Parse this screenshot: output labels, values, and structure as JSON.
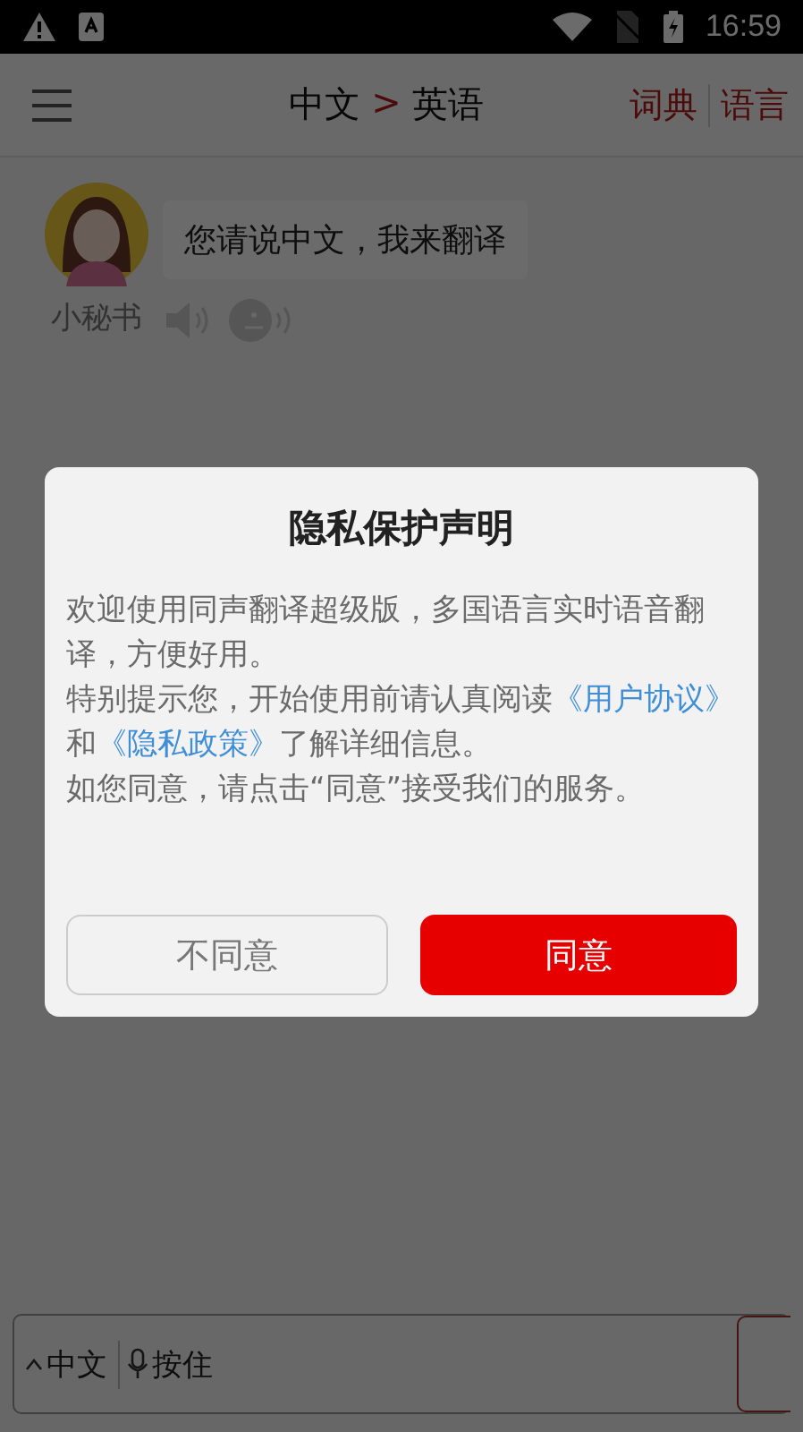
{
  "status_bar": {
    "time": "16:59"
  },
  "header": {
    "source_language": "中文",
    "arrow": ">",
    "target_language": "英语",
    "actions": [
      {
        "label": "词典"
      },
      {
        "label": "语言"
      }
    ]
  },
  "chat": {
    "assistant_name": "小秘书",
    "message": "您请说中文，我来翻译"
  },
  "bottom_bar": {
    "language": "中文",
    "hold_label": "按住"
  },
  "dialog": {
    "title": "隐私保护声明",
    "paragraphs": [
      [
        {
          "kind": "text",
          "text": "欢迎使用同声翻译超级版，多国语言实时语音翻译，方便好用。"
        }
      ],
      [
        {
          "kind": "text",
          "text": "特别提示您，开始使用前请认真阅读"
        },
        {
          "kind": "link",
          "text": "《用户协议》"
        },
        {
          "kind": "text",
          "text": "和"
        },
        {
          "kind": "link",
          "text": "《隐私政策》"
        },
        {
          "kind": "text",
          "text": "了解详细信息。"
        }
      ],
      [
        {
          "kind": "text",
          "text": "如您同意，请点击“同意”接受我们的服务。"
        }
      ]
    ],
    "buttons": [
      {
        "label": "不同意",
        "kind": "secondary"
      },
      {
        "label": "同意",
        "kind": "primary"
      }
    ]
  }
}
